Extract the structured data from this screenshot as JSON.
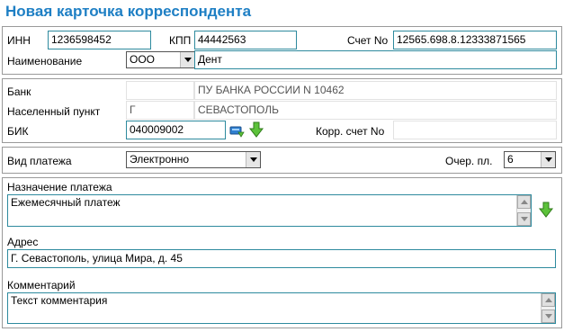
{
  "title": "Новая карточка корреспондента",
  "inn": {
    "label": "ИНН",
    "value": "1236598452"
  },
  "kpp": {
    "label": "КПП",
    "value": "44442563"
  },
  "account": {
    "label": "Счет No",
    "value": "12565.698.8.12333871565"
  },
  "name": {
    "label": "Наименование",
    "org_form": "ООО",
    "value": "Дент"
  },
  "bank": {
    "label": "Банк",
    "code": "",
    "value": "ПУ БАНКА РОССИИ N 10462"
  },
  "locality": {
    "label": "Населенный пункт",
    "type": "Г",
    "value": "СЕВАСТОПОЛЬ"
  },
  "bik": {
    "label": "БИК",
    "value": "040009002"
  },
  "corr_account": {
    "label": "Корр. счет No",
    "value": ""
  },
  "payment_type": {
    "label": "Вид платежа",
    "value": "Электронно"
  },
  "priority": {
    "label": "Очер. пл.",
    "value": "6"
  },
  "purpose": {
    "label": "Назначение платежа",
    "value": "Ежемесячный платеж"
  },
  "address": {
    "label": "Адрес",
    "value": "Г. Севастополь, улица Мира, д. 45"
  },
  "comment": {
    "label": "Комментарий",
    "value": "Текст комментария"
  },
  "icons": {
    "bank_lookup": "bank-lookup-icon",
    "down_arrow": "green-down-arrow-icon",
    "accent_green": "#5cc23a",
    "accent_blue": "#1e7fc4"
  }
}
